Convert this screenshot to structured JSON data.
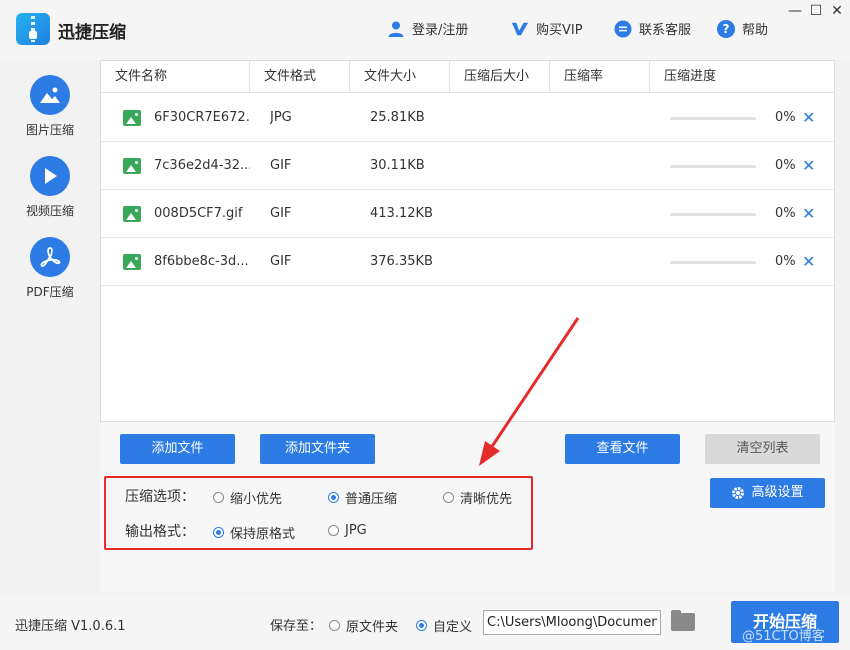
{
  "app": {
    "name": "迅捷压缩",
    "version": "迅捷压缩 V1.0.6.1"
  },
  "header": {
    "login": "登录/注册",
    "vip": "购买VIP",
    "service": "联系客服",
    "help": "帮助",
    "min": "—",
    "max": "☐",
    "close": "✕"
  },
  "sidebar": [
    {
      "label": "图片压缩",
      "icon": "image-icon"
    },
    {
      "label": "视频压缩",
      "icon": "play-icon"
    },
    {
      "label": "PDF压缩",
      "icon": "pdf-icon"
    }
  ],
  "table": {
    "columns": [
      "文件名称",
      "文件格式",
      "文件大小",
      "压缩后大小",
      "压缩率",
      "压缩进度"
    ],
    "rows": [
      {
        "name": "6F30CR7E672...",
        "format": "JPG",
        "size": "25.81KB",
        "compressed": "",
        "rate": "",
        "progress_text": "0%",
        "progress": 0
      },
      {
        "name": "7c36e2d4-32...",
        "format": "GIF",
        "size": "30.11KB",
        "compressed": "",
        "rate": "",
        "progress_text": "0%",
        "progress": 0
      },
      {
        "name": "008D5CF7.gif",
        "format": "GIF",
        "size": "413.12KB",
        "compressed": "",
        "rate": "",
        "progress_text": "0%",
        "progress": 0
      },
      {
        "name": "8f6bbe8c-3d...",
        "format": "GIF",
        "size": "376.35KB",
        "compressed": "",
        "rate": "",
        "progress_text": "0%",
        "progress": 0
      }
    ],
    "remove_glyph": "✕"
  },
  "buttons": {
    "add_file": "添加文件",
    "add_folder": "添加文件夹",
    "view_files": "查看文件",
    "clear_list": "清空列表",
    "advanced": "高级设置",
    "start": "开始压缩"
  },
  "options": {
    "compress_label": "压缩选项：",
    "compress_choices": [
      "缩小优先",
      "普通压缩",
      "清晰优先"
    ],
    "compress_selected": "普通压缩",
    "format_label": "输出格式：",
    "format_choices": [
      "保持原格式",
      "JPG"
    ],
    "format_selected": "保持原格式"
  },
  "save": {
    "label": "保存至：",
    "choices": [
      "原文件夹",
      "自定义"
    ],
    "selected": "自定义",
    "path": "C:\\Users\\Mloong\\Documents"
  },
  "watermark": "@51CTO博客",
  "colors": {
    "accent": "#2d7be5",
    "annotation": "#e52c2c",
    "file_icon": "#3aa85a"
  }
}
